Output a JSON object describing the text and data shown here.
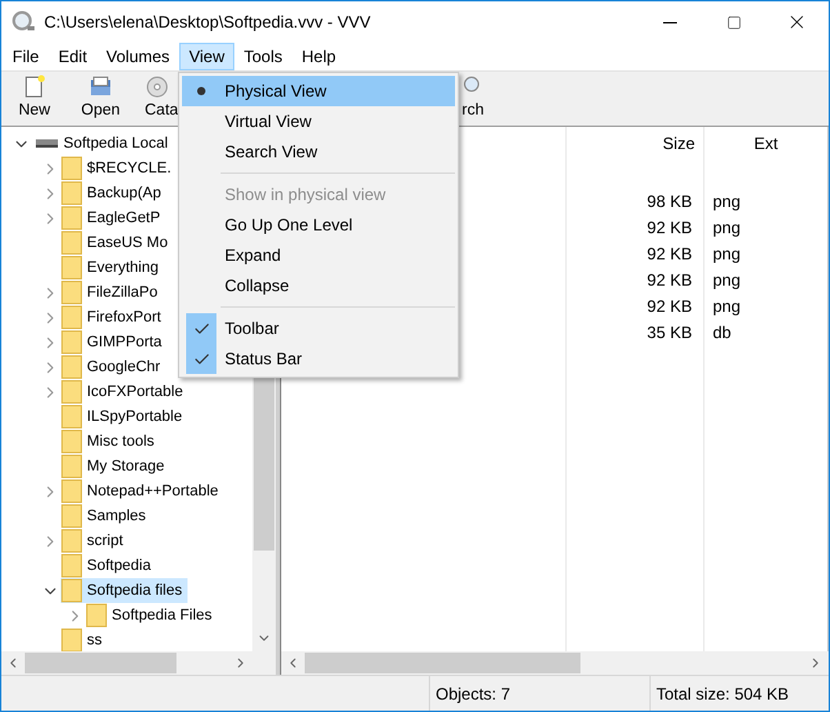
{
  "window": {
    "title": "C:\\Users\\elena\\Desktop\\Softpedia.vvv - VVV"
  },
  "menu_bar": [
    {
      "label": "File",
      "selected": false
    },
    {
      "label": "Edit",
      "selected": false
    },
    {
      "label": "Volumes",
      "selected": false
    },
    {
      "label": "View",
      "selected": true
    },
    {
      "label": "Tools",
      "selected": false
    },
    {
      "label": "Help",
      "selected": false
    }
  ],
  "toolbar": [
    {
      "label": "New",
      "kind": "new"
    },
    {
      "label": "Open",
      "kind": "open"
    },
    {
      "label": "Cata",
      "kind": "catalog"
    },
    {
      "label": "rch",
      "kind": "search"
    }
  ],
  "tree": {
    "root": {
      "label": "Softpedia Local",
      "expanded": true,
      "children": [
        {
          "label": "$RECYCLE.",
          "expandable": true,
          "selected": false
        },
        {
          "label": "Backup(Ap",
          "expandable": true,
          "selected": false
        },
        {
          "label": "EagleGetP",
          "expandable": true,
          "selected": false
        },
        {
          "label": "EaseUS Mo",
          "expandable": false,
          "selected": false
        },
        {
          "label": "Everything",
          "expandable": false,
          "selected": false
        },
        {
          "label": "FileZillaPo",
          "expandable": true,
          "selected": false
        },
        {
          "label": "FirefoxPort",
          "expandable": true,
          "selected": false
        },
        {
          "label": "GIMPPorta",
          "expandable": true,
          "selected": false
        },
        {
          "label": "GoogleChr",
          "expandable": true,
          "selected": false
        },
        {
          "label": "IcoFXPortable",
          "expandable": true,
          "selected": false
        },
        {
          "label": "ILSpyPortable",
          "expandable": false,
          "selected": false
        },
        {
          "label": "Misc tools",
          "expandable": false,
          "selected": false
        },
        {
          "label": "My Storage",
          "expandable": false,
          "selected": false
        },
        {
          "label": "Notepad++Portable",
          "expandable": true,
          "selected": false
        },
        {
          "label": "Samples",
          "expandable": false,
          "selected": false
        },
        {
          "label": "script",
          "expandable": true,
          "selected": false
        },
        {
          "label": "Softpedia",
          "expandable": false,
          "selected": false
        },
        {
          "label": "Softpedia files",
          "expandable": true,
          "expanded": true,
          "selected": true,
          "children": [
            {
              "label": "Softpedia Files",
              "expandable": true,
              "selected": false
            }
          ]
        },
        {
          "label": "ss",
          "expandable": false,
          "selected": false
        }
      ]
    }
  },
  "file_list": {
    "columns": [
      "Size",
      "Ext"
    ],
    "rows": [
      [
        "98 KB",
        "png"
      ],
      [
        "92 KB",
        "png"
      ],
      [
        "92 KB",
        "png"
      ],
      [
        "92 KB",
        "png"
      ],
      [
        "92 KB",
        "png"
      ],
      [
        "35 KB",
        "db"
      ]
    ]
  },
  "view_menu": [
    {
      "kind": "radio",
      "label": "Physical View",
      "selected": true,
      "highlighted": true
    },
    {
      "kind": "radio",
      "label": "Virtual View",
      "selected": false,
      "highlighted": false
    },
    {
      "kind": "radio",
      "label": "Search View",
      "selected": false,
      "highlighted": false
    },
    {
      "kind": "separator"
    },
    {
      "kind": "item",
      "label": "Show in physical view",
      "disabled": true
    },
    {
      "kind": "item",
      "label": "Go Up One Level",
      "disabled": false
    },
    {
      "kind": "item",
      "label": "Expand",
      "disabled": false
    },
    {
      "kind": "item",
      "label": "Collapse",
      "disabled": false
    },
    {
      "kind": "separator"
    },
    {
      "kind": "check",
      "label": "Toolbar",
      "checked": true
    },
    {
      "kind": "check",
      "label": "Status Bar",
      "checked": true
    }
  ],
  "status_bar": {
    "objects": "Objects: 7",
    "total_size": "Total size: 504 KB"
  }
}
